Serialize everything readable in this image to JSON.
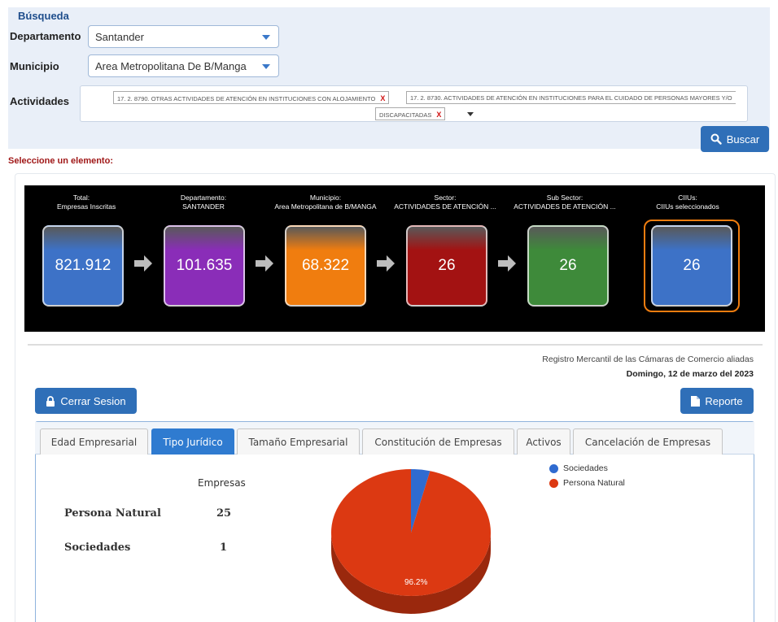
{
  "search": {
    "title": "Búsqueda",
    "departamento_label": "Departamento",
    "departamento_value": "Santander",
    "municipio_label": "Municipio",
    "municipio_value": "Area Metropolitana De B/Manga",
    "actividades_label": "Actividades",
    "chips": [
      "17. 2. 8790. OTRAS ACTIVIDADES DE ATENCIÓN EN INSTITUCIONES CON ALOJAMIENTO",
      "17. 2. 8730. ACTIVIDADES DE ATENCIÓN EN INSTITUCIONES PARA EL CUIDADO DE PERSONAS MAYORES Y/O",
      "DISCAPACITADAS"
    ],
    "chip_remove": "X",
    "buscar_label": "Buscar"
  },
  "select_title": "Seleccione un elemento:",
  "funnel": [
    {
      "label1": "Total:",
      "label2": "Empresas Inscritas",
      "value": "821.912",
      "color": "#3d72c7"
    },
    {
      "label1": "Departamento:",
      "label2": "SANTANDER",
      "value": "101.635",
      "color": "#8a2db8"
    },
    {
      "label1": "Municipio:",
      "label2": "Area Metropolitana de B/MANGA",
      "value": "68.322",
      "color": "#f07d0f"
    },
    {
      "label1": "Sector:",
      "label2": "ACTIVIDADES DE ATENCIÓN ...",
      "value": "26",
      "color": "#a31212"
    },
    {
      "label1": "Sub Sector:",
      "label2": "ACTIVIDADES DE ATENCIÓN ...",
      "value": "26",
      "color": "#3e8a3a"
    },
    {
      "label1": "CIIUs:",
      "label2": "CIIUs seleccionados",
      "value": "26",
      "color": "#3d72c7"
    }
  ],
  "registro": {
    "text": "Registro Mercantil de las Cámaras de Comercio aliadas",
    "date": "Domingo, 12 de marzo del 2023"
  },
  "buttons": {
    "cerrar_sesion": "Cerrar Sesion",
    "reporte": "Reporte"
  },
  "tabs": [
    "Edad Empresarial",
    "Tipo Jurídico",
    "Tamaño Empresarial",
    "Constitución de Empresas",
    "Activos",
    "Cancelación de Empresas"
  ],
  "stats": {
    "header": "Empresas",
    "rows": [
      {
        "label": "Persona Natural",
        "value": "25"
      },
      {
        "label": "Sociedades",
        "value": "1"
      }
    ]
  },
  "chart_data": {
    "type": "pie",
    "title": "",
    "slices": [
      {
        "label": "Sociedades",
        "value": 1,
        "percent": 3.8,
        "color": "#2f6bd0"
      },
      {
        "label": "Persona Natural",
        "value": 25,
        "percent": 96.2,
        "color": "#dc3912"
      }
    ],
    "data_labels": [
      "96.2%"
    ],
    "legend_position": "top-right"
  }
}
